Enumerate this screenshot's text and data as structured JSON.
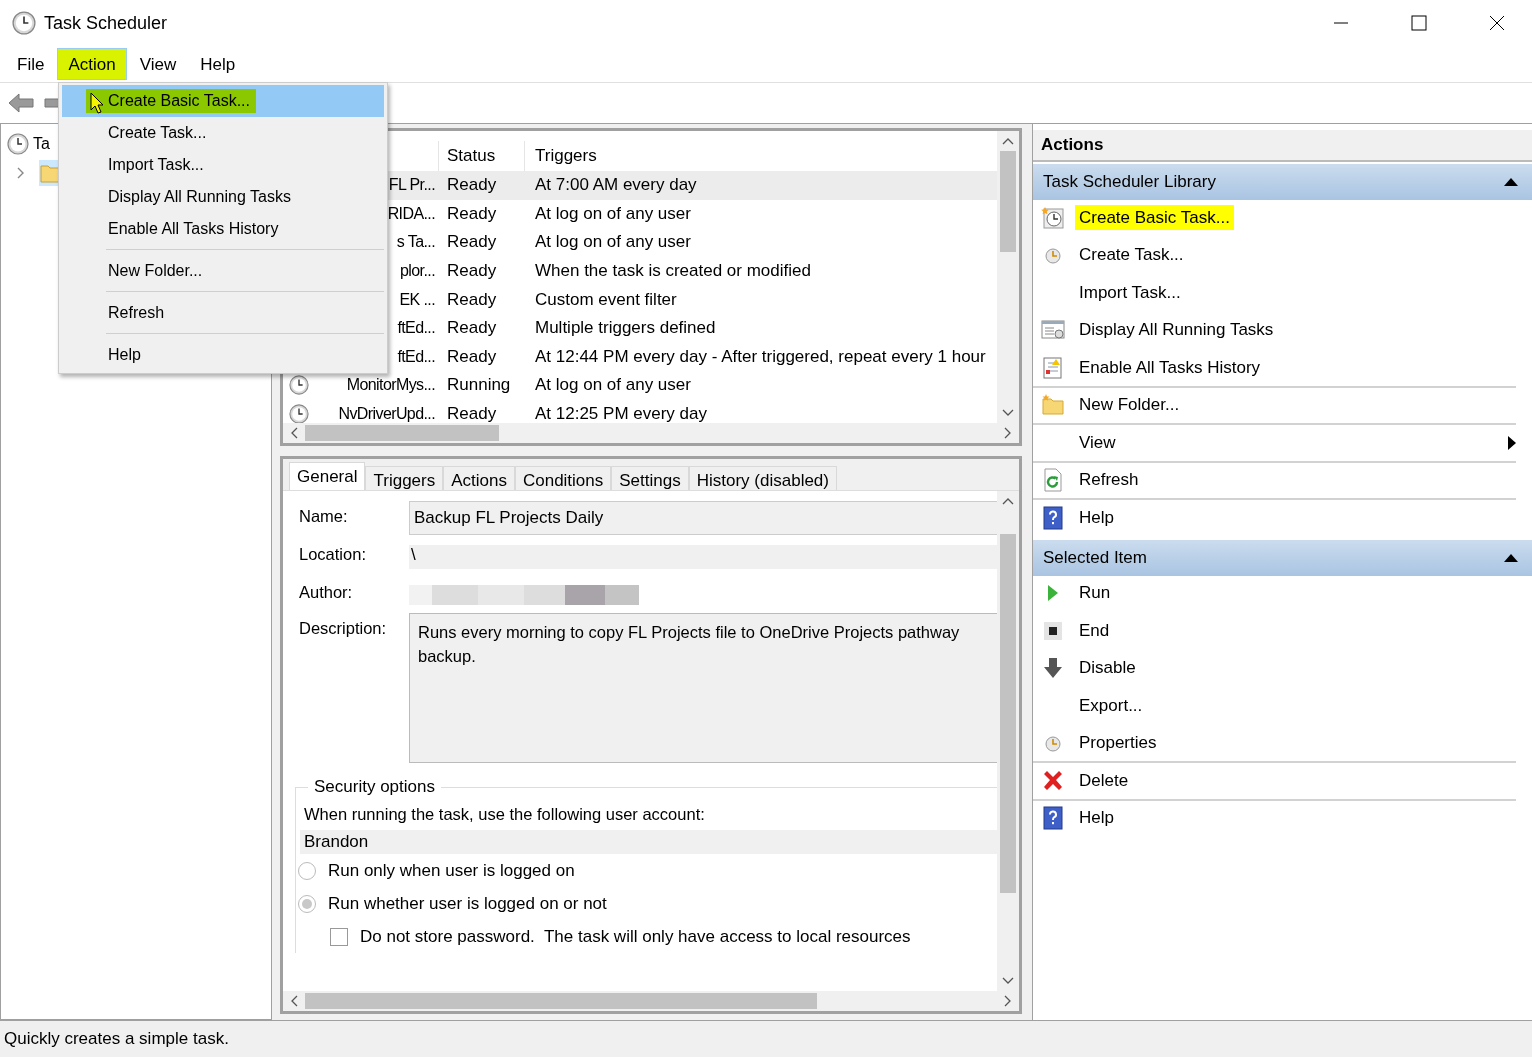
{
  "window": {
    "title": "Task Scheduler"
  },
  "menubar": [
    {
      "label": "File",
      "selected": false,
      "highlighted": false
    },
    {
      "label": "Action",
      "selected": true,
      "highlighted": true
    },
    {
      "label": "View",
      "selected": false,
      "highlighted": false
    },
    {
      "label": "Help",
      "selected": false,
      "highlighted": false
    }
  ],
  "action_menu": [
    {
      "label": "Create Basic Task...",
      "selected": true,
      "highlighted": true,
      "divider_after": false
    },
    {
      "label": "Create Task...",
      "selected": false,
      "highlighted": false,
      "divider_after": false
    },
    {
      "label": "Import Task...",
      "selected": false,
      "highlighted": false,
      "divider_after": false
    },
    {
      "label": "Display All Running Tasks",
      "selected": false,
      "highlighted": false,
      "divider_after": false
    },
    {
      "label": "Enable All Tasks History",
      "selected": false,
      "highlighted": false,
      "divider_after": true
    },
    {
      "label": "New Folder...",
      "selected": false,
      "highlighted": false,
      "divider_after": true
    },
    {
      "label": "Refresh",
      "selected": false,
      "highlighted": false,
      "divider_after": true
    },
    {
      "label": "Help",
      "selected": false,
      "highlighted": false,
      "divider_after": false
    }
  ],
  "tree": [
    {
      "label": "Ta",
      "kind": "clock",
      "selected": false,
      "children": [
        {
          "kind": "folder",
          "selected": true,
          "expanded": false
        }
      ]
    }
  ],
  "tasks": {
    "columns": [
      "Status",
      "Triggers"
    ],
    "rows": [
      {
        "name": "FL Pr...",
        "status": "Ready",
        "triggers": "At 7:00 AM every day",
        "selected": true
      },
      {
        "name": "RIDA...",
        "status": "Ready",
        "triggers": "At log on of any user",
        "selected": false
      },
      {
        "name": "s Ta...",
        "status": "Ready",
        "triggers": "At log on of any user",
        "selected": false
      },
      {
        "name": "plor...",
        "status": "Ready",
        "triggers": "When the task is created or modified",
        "selected": false
      },
      {
        "name": "EK ...",
        "status": "Ready",
        "triggers": "Custom event filter",
        "selected": false
      },
      {
        "name": "ftEd...",
        "status": "Ready",
        "triggers": "Multiple triggers defined",
        "selected": false
      },
      {
        "name": "ftEd...",
        "status": "Ready",
        "triggers": "At 12:44 PM every day - After triggered, repeat every 1 hour",
        "selected": false
      },
      {
        "name": "MonitorMys...",
        "icon": true,
        "status": "Running",
        "triggers": "At log on of any user",
        "selected": false
      },
      {
        "name": "NvDriverUpd...",
        "icon": true,
        "status": "Ready",
        "triggers": "At 12:25 PM every day",
        "selected": false
      }
    ]
  },
  "details": {
    "tabs": [
      {
        "label": "General",
        "selected": true
      },
      {
        "label": "Triggers",
        "selected": false
      },
      {
        "label": "Actions",
        "selected": false
      },
      {
        "label": "Conditions",
        "selected": false
      },
      {
        "label": "Settings",
        "selected": false
      },
      {
        "label": "History (disabled)",
        "selected": false
      }
    ],
    "name_label": "Name:",
    "name": "Backup FL Projects Daily",
    "location_label": "Location:",
    "location": "\\",
    "author_label": "Author:",
    "author": {
      "kind": "redacted"
    },
    "description_label": "Description:",
    "description": "Runs every morning to copy FL Projects file to OneDrive Projects pathway backup.",
    "security": {
      "title": "Security options",
      "account_prompt": "When running the task, use the following user account:",
      "account": "Brandon",
      "options": [
        {
          "label": "Run only when user is logged on",
          "selected": false
        },
        {
          "label": "Run whether user is logged on or not",
          "selected": true
        }
      ],
      "store_password": {
        "label": "Do not store password.  The task will only have access to local resources",
        "checked": false
      }
    }
  },
  "actions_pane": {
    "title": "Actions",
    "sections": [
      {
        "title": "Task Scheduler Library",
        "expanded": true,
        "items": [
          {
            "label": "Create Basic Task...",
            "kind": "clock-star",
            "highlighted": true,
            "submenu": false,
            "divider_after": false
          },
          {
            "label": "Create Task...",
            "kind": "clock-small",
            "highlighted": false,
            "submenu": false,
            "divider_after": false
          },
          {
            "label": "Import Task...",
            "kind": "plain",
            "highlighted": false,
            "submenu": false,
            "divider_after": false
          },
          {
            "label": "Display All Running Tasks",
            "kind": "list",
            "highlighted": false,
            "submenu": false,
            "divider_after": false
          },
          {
            "label": "Enable All Tasks History",
            "kind": "notebook",
            "highlighted": false,
            "submenu": false,
            "divider_after": true
          },
          {
            "label": "New Folder...",
            "kind": "folder",
            "highlighted": false,
            "submenu": false,
            "divider_after": true
          },
          {
            "label": "View",
            "kind": "plain",
            "highlighted": false,
            "submenu": true,
            "divider_after": true
          },
          {
            "label": "Refresh",
            "kind": "refresh",
            "highlighted": false,
            "submenu": false,
            "divider_after": true
          },
          {
            "label": "Help",
            "kind": "help",
            "highlighted": false,
            "submenu": false,
            "divider_after": false
          }
        ]
      },
      {
        "title": "Selected Item",
        "expanded": true,
        "items": [
          {
            "label": "Run",
            "kind": "run",
            "highlighted": false,
            "submenu": false,
            "divider_after": false
          },
          {
            "label": "End",
            "kind": "end",
            "highlighted": false,
            "submenu": false,
            "divider_after": false
          },
          {
            "label": "Disable",
            "kind": "disable",
            "highlighted": false,
            "submenu": false,
            "divider_after": false
          },
          {
            "label": "Export...",
            "kind": "plain",
            "highlighted": false,
            "submenu": false,
            "divider_after": false
          },
          {
            "label": "Properties",
            "kind": "clock-small",
            "highlighted": false,
            "submenu": false,
            "divider_after": true
          },
          {
            "label": "Delete",
            "kind": "delete",
            "highlighted": false,
            "submenu": false,
            "divider_after": true
          },
          {
            "label": "Help",
            "kind": "help",
            "highlighted": false,
            "submenu": false,
            "divider_after": false
          }
        ]
      }
    ]
  },
  "status_bar": "Quickly creates a simple task."
}
